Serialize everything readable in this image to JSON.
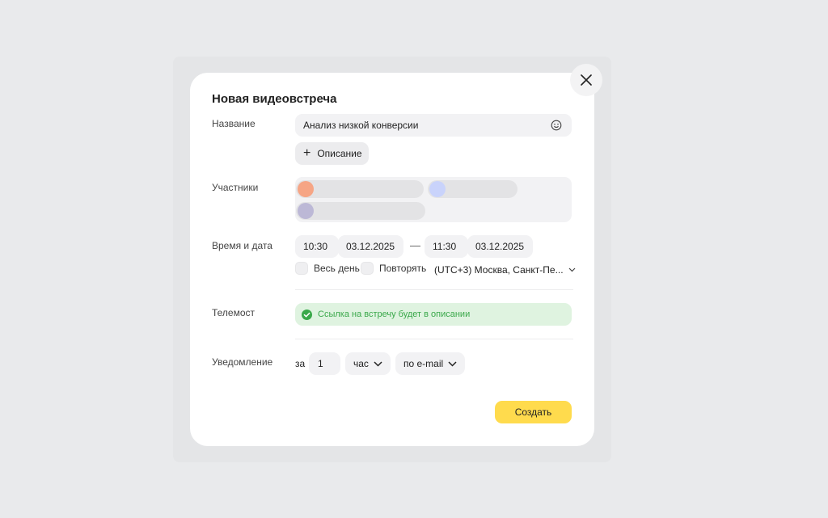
{
  "dialog": {
    "title": "Новая видеовстреча",
    "close_icon": "close-icon"
  },
  "fields": {
    "name_label": "Название",
    "name_value": "Анализ низкой конверсии",
    "description_button": "Описание",
    "participants_label": "Участники",
    "participants": [
      {
        "avatar_color": "#f6a585"
      },
      {
        "avatar_color": "#c9d3fb"
      },
      {
        "avatar_color": "#bcb8d6"
      }
    ],
    "time_label": "Время и дата",
    "start_time": "10:30",
    "start_date": "03.12.2025",
    "separator": "—",
    "end_time": "11:30",
    "end_date": "03.12.2025",
    "all_day": "Весь день",
    "repeat": "Повторять",
    "timezone": "(UTC+3) Москва, Санкт-Пе...",
    "telemost_label": "Телемост",
    "telemost_info": "Ссылка на встречу будет в описании",
    "notification_label": "Уведомление",
    "notify_prefix": "за",
    "notify_amount": "1",
    "notify_unit": "час",
    "notify_channel": "по e-mail"
  },
  "actions": {
    "create": "Создать"
  },
  "colors": {
    "accent": "#ffdb4d",
    "success_bg": "#dff3e0",
    "success_text": "#3aa84a"
  }
}
